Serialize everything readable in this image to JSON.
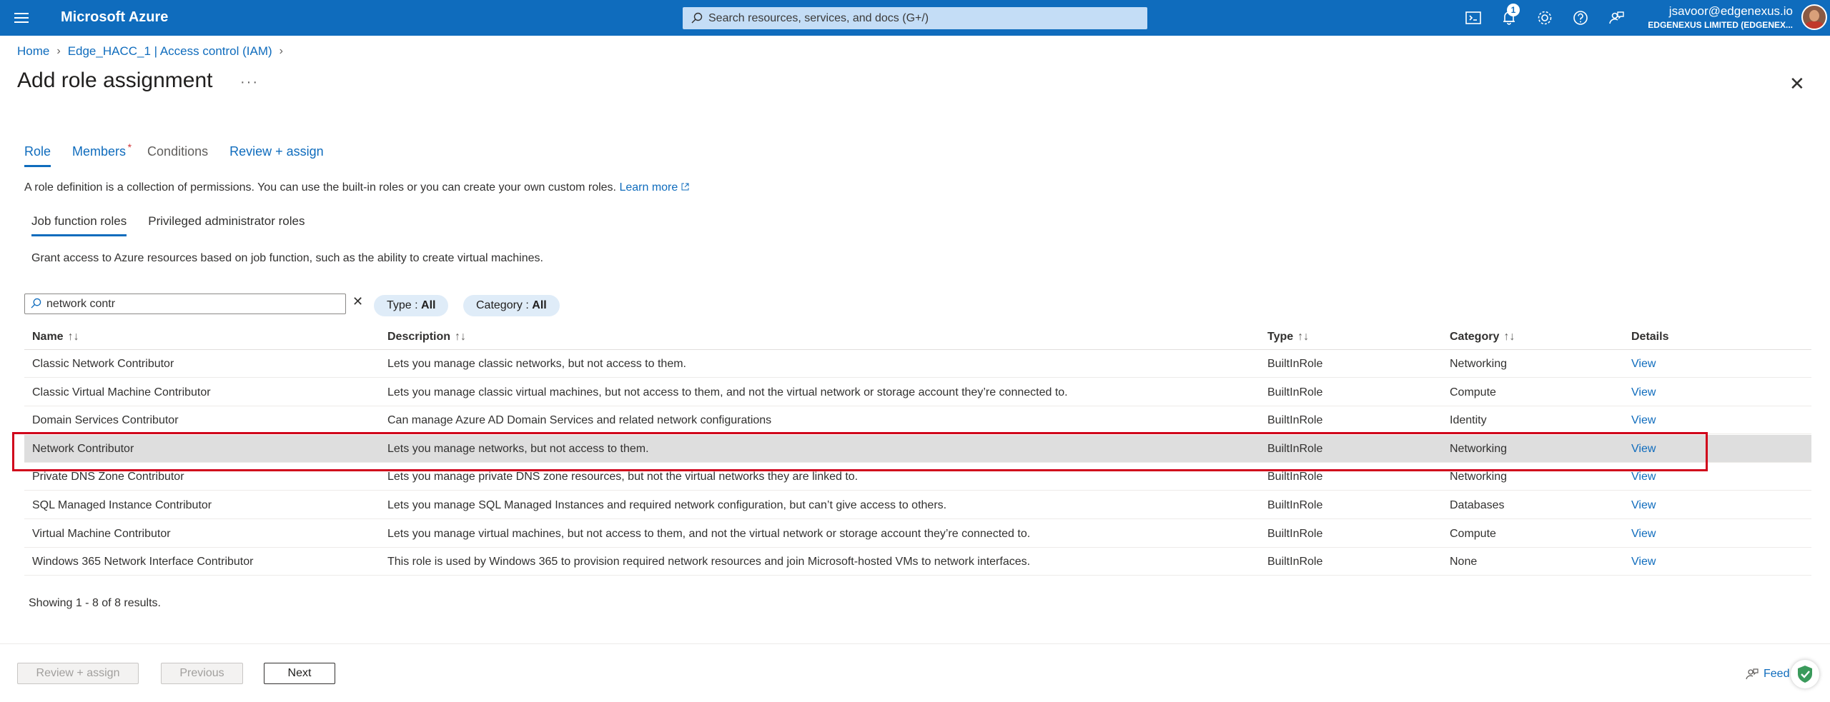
{
  "topbar": {
    "brand": "Microsoft Azure",
    "search_placeholder": "Search resources, services, and docs (G+/)",
    "notification_count": "1",
    "account_email": "jsavoor@edgenexus.io",
    "account_org": "EDGENEXUS LIMITED (EDGENEX..."
  },
  "breadcrumb": {
    "home": "Home",
    "parent": "Edge_HACC_1 | Access control (IAM)"
  },
  "page": {
    "title": "Add role assignment",
    "more": "···",
    "close": "✕"
  },
  "tabs": {
    "role": "Role",
    "members": "Members",
    "members_required": "*",
    "conditions": "Conditions",
    "review": "Review + assign"
  },
  "intro": {
    "text": "A role definition is a collection of permissions. You can use the built-in roles or you can create your own custom roles.",
    "link": "Learn more"
  },
  "subtabs": {
    "job": "Job function roles",
    "privileged": "Privileged administrator roles",
    "description": "Grant access to Azure resources based on job function, such as the ability to create virtual machines."
  },
  "filter": {
    "value": "network contr",
    "type_label": "Type : ",
    "type_value": "All",
    "category_label": "Category : ",
    "category_value": "All"
  },
  "table": {
    "headers": {
      "name": "Name",
      "description": "Description",
      "type": "Type",
      "category": "Category",
      "details": "Details"
    },
    "rows": [
      {
        "name": "Classic Network Contributor",
        "description": "Lets you manage classic networks, but not access to them.",
        "type": "BuiltInRole",
        "category": "Networking",
        "details": "View"
      },
      {
        "name": "Classic Virtual Machine Contributor",
        "description": "Lets you manage classic virtual machines, but not access to them, and not the virtual network or storage account they’re connected to.",
        "type": "BuiltInRole",
        "category": "Compute",
        "details": "View"
      },
      {
        "name": "Domain Services Contributor",
        "description": "Can manage Azure AD Domain Services and related network configurations",
        "type": "BuiltInRole",
        "category": "Identity",
        "details": "View"
      },
      {
        "name": "Network Contributor",
        "description": "Lets you manage networks, but not access to them.",
        "type": "BuiltInRole",
        "category": "Networking",
        "details": "View"
      },
      {
        "name": "Private DNS Zone Contributor",
        "description": "Lets you manage private DNS zone resources, but not the virtual networks they are linked to.",
        "type": "BuiltInRole",
        "category": "Networking",
        "details": "View"
      },
      {
        "name": "SQL Managed Instance Contributor",
        "description": "Lets you manage SQL Managed Instances and required network configuration, but can’t give access to others.",
        "type": "BuiltInRole",
        "category": "Databases",
        "details": "View"
      },
      {
        "name": "Virtual Machine Contributor",
        "description": "Lets you manage virtual machines, but not access to them, and not the virtual network or storage account they’re connected to.",
        "type": "BuiltInRole",
        "category": "Compute",
        "details": "View"
      },
      {
        "name": "Windows 365 Network Interface Contributor",
        "description": "This role is used by Windows 365 to provision required network resources and join Microsoft-hosted VMs to network interfaces.",
        "type": "BuiltInRole",
        "category": "None",
        "details": "View"
      }
    ],
    "selected_row_index": 3,
    "showing": "Showing 1 - 8 of 8 results."
  },
  "footer": {
    "review_assign": "Review + assign",
    "previous": "Previous",
    "next": "Next",
    "feedback": "Feed"
  },
  "colors": {
    "topbar": "#0f6cbd",
    "link": "#0f6cbd",
    "highlight_border": "#d0021b",
    "selected_row": "#dedede"
  }
}
